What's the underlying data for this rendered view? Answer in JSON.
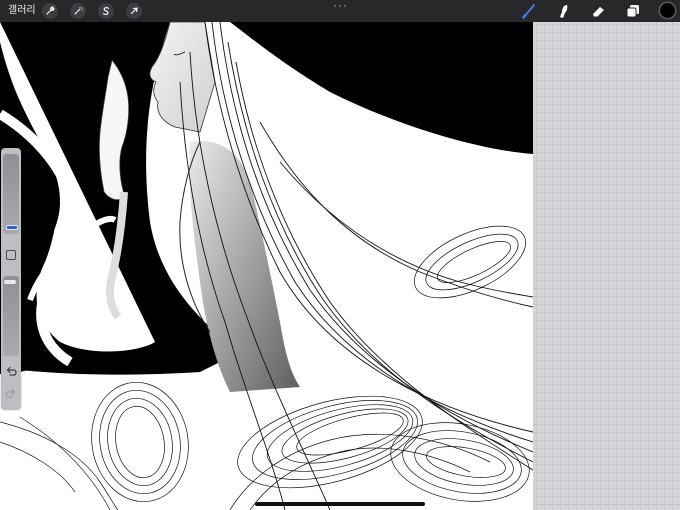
{
  "topbar": {
    "gallery_label": "갤러리",
    "left_tools": [
      {
        "name": "actions",
        "icon": "wrench-icon"
      },
      {
        "name": "adjustments",
        "icon": "magic-wand-icon"
      },
      {
        "name": "selection",
        "icon": "selection-s-icon"
      },
      {
        "name": "transform",
        "icon": "arrow-cursor-icon"
      }
    ],
    "right_tools": [
      {
        "name": "brush",
        "icon": "brush-icon",
        "active": true
      },
      {
        "name": "smudge",
        "icon": "smudge-icon",
        "active": false
      },
      {
        "name": "eraser",
        "icon": "eraser-icon",
        "active": false
      },
      {
        "name": "layers",
        "icon": "layers-icon",
        "active": false
      }
    ],
    "current_color": "#000000",
    "active_tool_color": "#3b82f6"
  },
  "sidebar": {
    "brush_size_icon": "size-slider",
    "modify_icon": "square-icon",
    "brush_opacity_icon": "opacity-slider",
    "undo_icon": "undo-icon",
    "redo_icon": "redo-icon"
  },
  "canvas": {
    "description_icon": "line-art-illustration",
    "background": "#ffffff",
    "ink": "#000000"
  }
}
